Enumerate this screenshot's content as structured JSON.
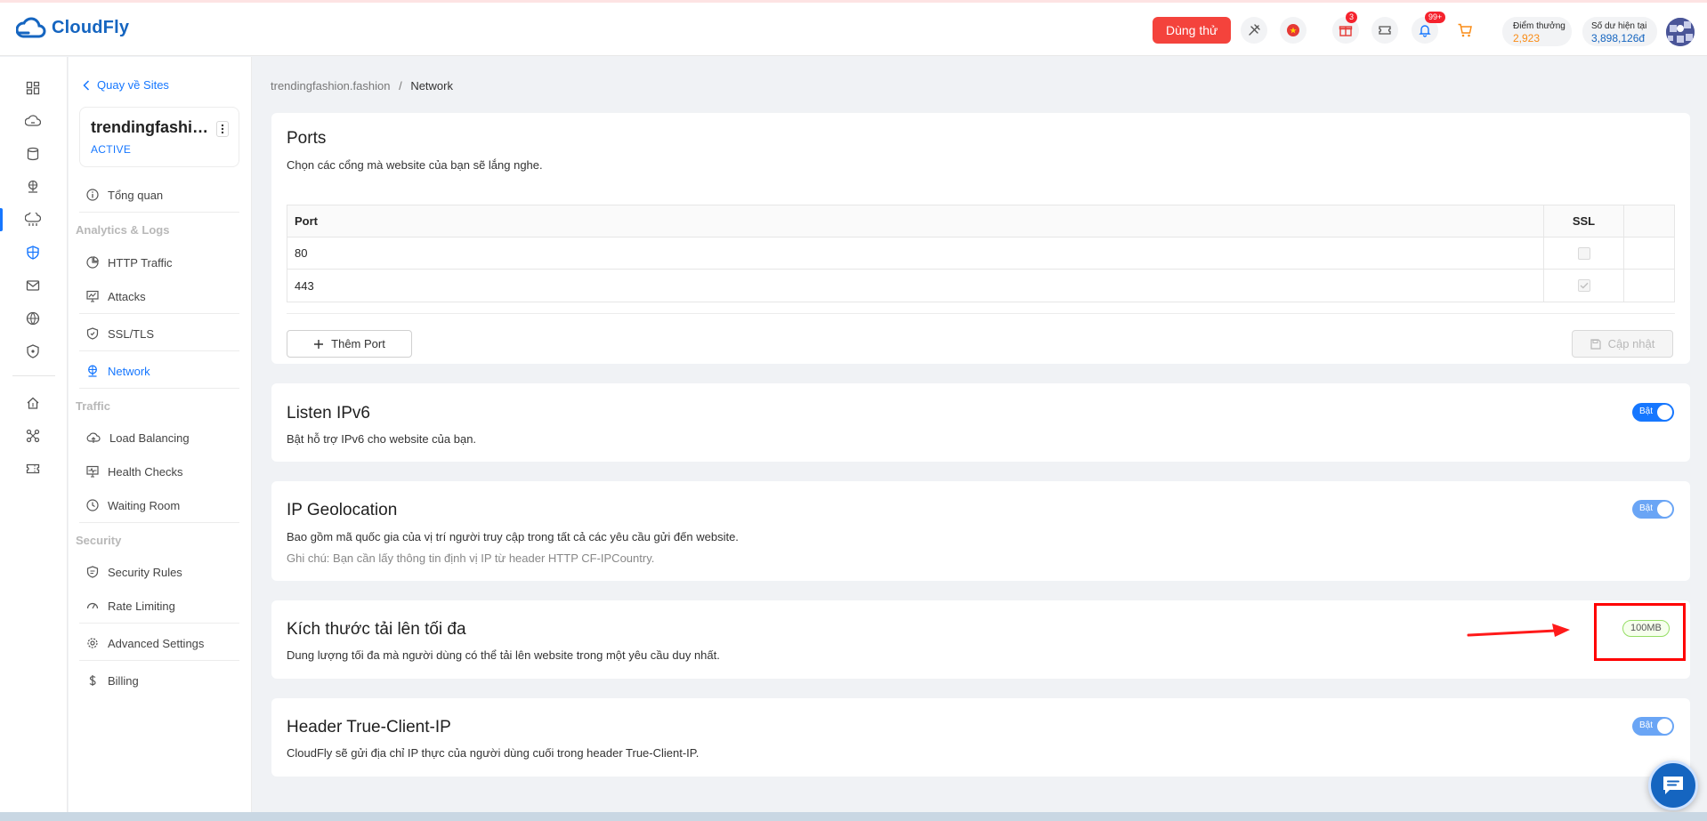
{
  "header": {
    "logo": "CloudFly",
    "trial_button": "Dùng thử",
    "gift_badge": "3",
    "notification_badge": "99+",
    "reward_label": "Điểm thưởng",
    "reward_value": "2,923",
    "balance_label": "Số dư hiện tại",
    "balance_value": "3,898,126đ"
  },
  "sidebar": {
    "back_link": "Quay về Sites",
    "site_name": "trendingfashion.fashion",
    "site_status": "ACTIVE",
    "overview": "Tổng quan",
    "group_analytics": "Analytics & Logs",
    "http_traffic": "HTTP Traffic",
    "attacks": "Attacks",
    "ssl_tls": "SSL/TLS",
    "network": "Network",
    "group_traffic": "Traffic",
    "load_balancing": "Load Balancing",
    "health_checks": "Health Checks",
    "waiting_room": "Waiting Room",
    "group_security": "Security",
    "security_rules": "Security Rules",
    "rate_limiting": "Rate Limiting",
    "advanced_settings": "Advanced Settings",
    "billing": "Billing"
  },
  "breadcrumb": {
    "site": "trendingfashion.fashion",
    "separator": "/",
    "current": "Network"
  },
  "ports": {
    "title": "Ports",
    "description": "Chọn các cổng mà website của bạn sẽ lắng nghe.",
    "col_port": "Port",
    "col_ssl": "SSL",
    "rows": [
      {
        "port": "80",
        "ssl": false
      },
      {
        "port": "443",
        "ssl": true
      }
    ],
    "add_button": "Thêm Port",
    "update_button": "Cập nhật"
  },
  "ipv6": {
    "title": "Listen IPv6",
    "description": "Bật hỗ trợ IPv6 cho website của bạn.",
    "toggle_label": "Bật"
  },
  "geolocation": {
    "title": "IP Geolocation",
    "description": "Bao gồm mã quốc gia của vị trí người truy cập trong tất cả các yêu cầu gửi đến website.",
    "note": "Ghi chú: Bạn cần lấy thông tin định vị IP từ header HTTP CF-IPCountry.",
    "toggle_label": "Bật"
  },
  "upload": {
    "title": "Kích thước tải lên tối đa",
    "description": "Dung lượng tối đa mà người dùng có thể tải lên website trong một yêu cầu duy nhất.",
    "value": "100MB"
  },
  "true_client_ip": {
    "title": "Header True-Client-IP",
    "description": "CloudFly sẽ gửi địa chỉ IP thực của người dùng cuối trong header True-Client-IP.",
    "toggle_label": "Bật"
  },
  "colors": {
    "brand": "#1565c0",
    "accent": "#1677ff",
    "danger": "#f4433c",
    "reward": "#fa8c16"
  }
}
